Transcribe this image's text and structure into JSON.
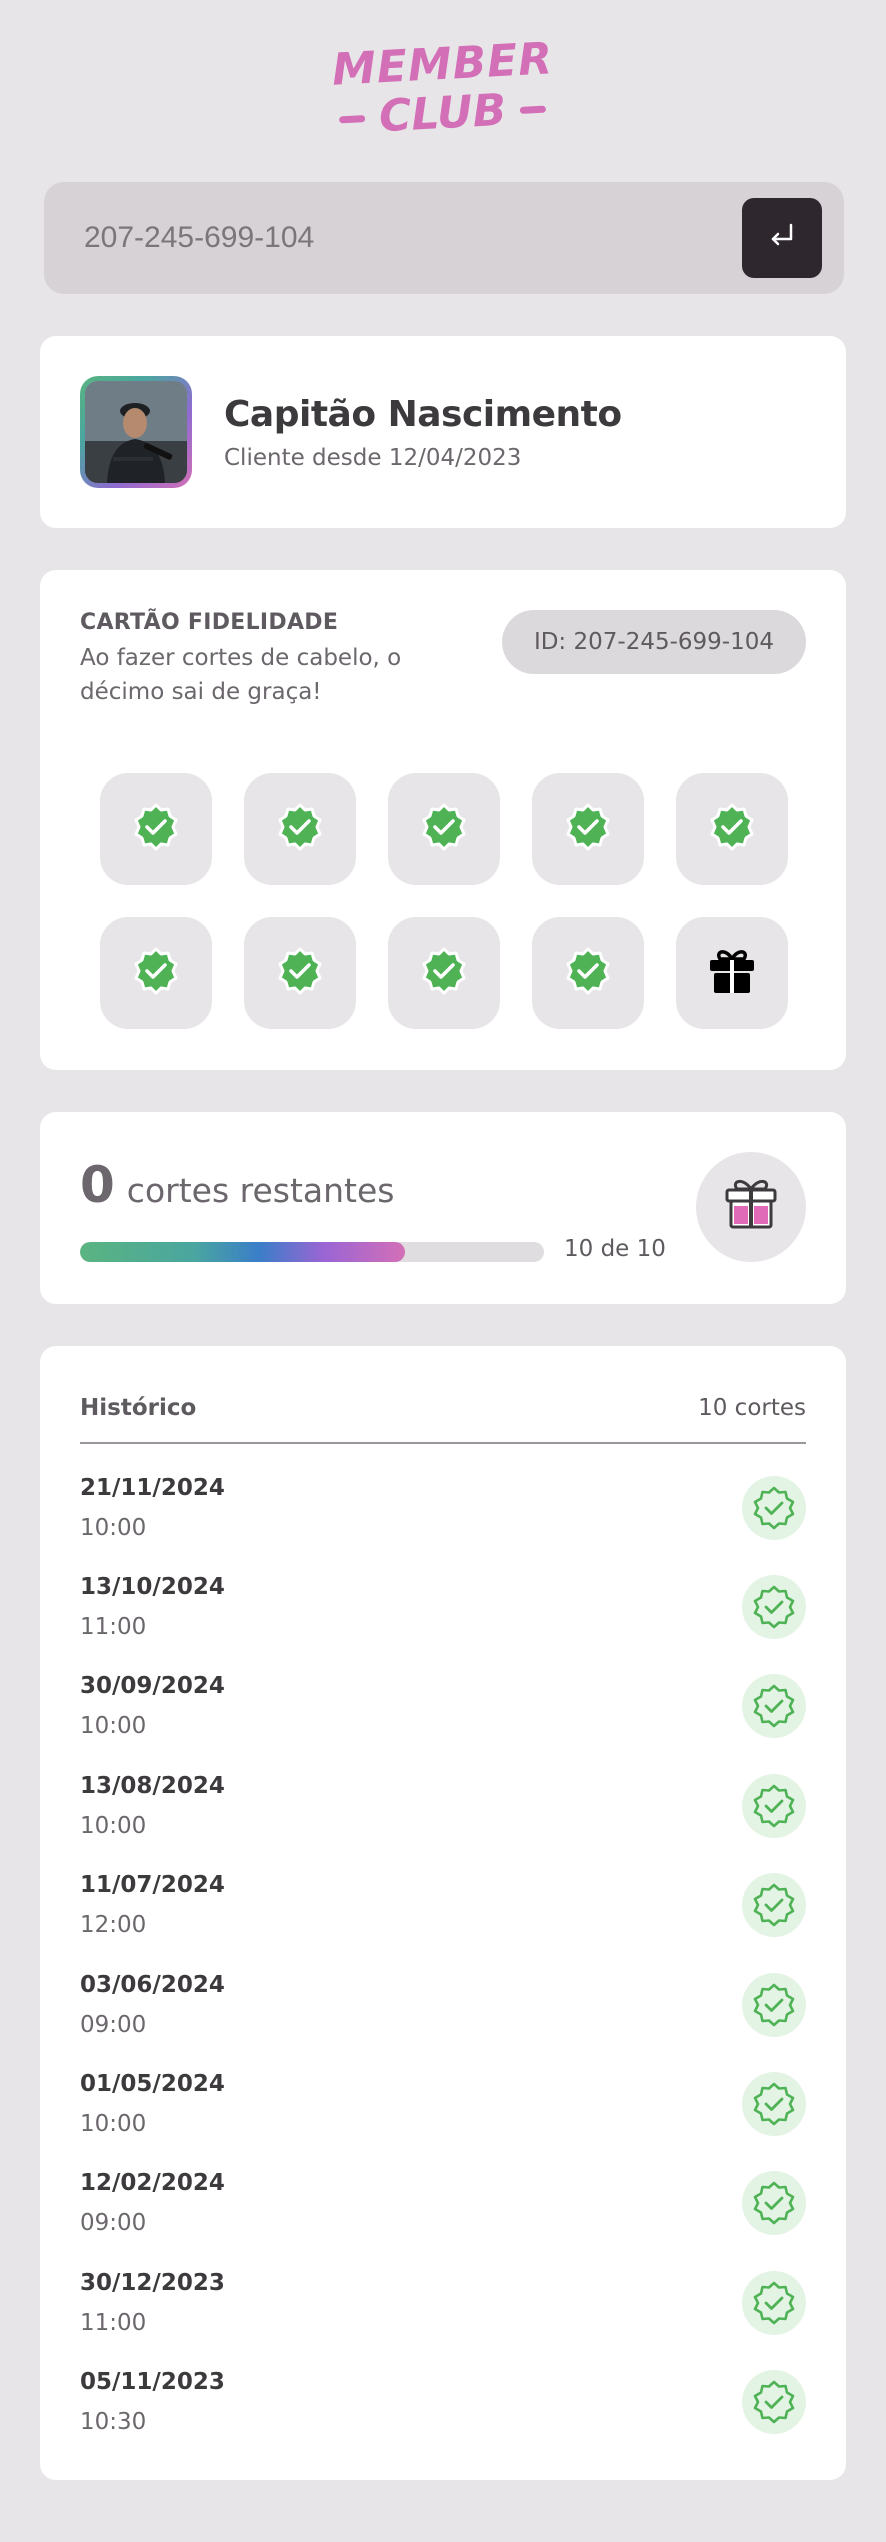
{
  "logo": {
    "line1": "MEMBER",
    "line2": "CLUB"
  },
  "search": {
    "value": "",
    "placeholder": "207-245-699-104"
  },
  "profile": {
    "name": "Capitão Nascimento",
    "since": "Cliente desde 12/04/2023"
  },
  "loyalty": {
    "title": "CARTÃO FIDELIDADE",
    "description": "Ao fazer cortes de cabelo, o décimo sai de graça!",
    "id_badge": "ID: 207-245-699-104",
    "stamps": [
      "check",
      "check",
      "check",
      "check",
      "check",
      "check",
      "check",
      "check",
      "check",
      "gift"
    ]
  },
  "remaining": {
    "count": "0",
    "label": "cortes restantes",
    "progress_text": "10 de 10",
    "progress_fraction": 0.7
  },
  "history": {
    "title": "Histórico",
    "count": "10 cortes",
    "items": [
      {
        "date": "21/11/2024",
        "time": "10:00"
      },
      {
        "date": "13/10/2024",
        "time": "11:00"
      },
      {
        "date": "30/09/2024",
        "time": "10:00"
      },
      {
        "date": "13/08/2024",
        "time": "10:00"
      },
      {
        "date": "11/07/2024",
        "time": "12:00"
      },
      {
        "date": "03/06/2024",
        "time": "09:00"
      },
      {
        "date": "01/05/2024",
        "time": "10:00"
      },
      {
        "date": "12/02/2024",
        "time": "09:00"
      },
      {
        "date": "30/12/2023",
        "time": "11:00"
      },
      {
        "date": "05/11/2023",
        "time": "10:30"
      }
    ]
  },
  "colors": {
    "brand_pink": "#d36fb7",
    "check_green": "#4fb356",
    "dark_button": "#2e272d",
    "background": "#e8e5e8"
  }
}
